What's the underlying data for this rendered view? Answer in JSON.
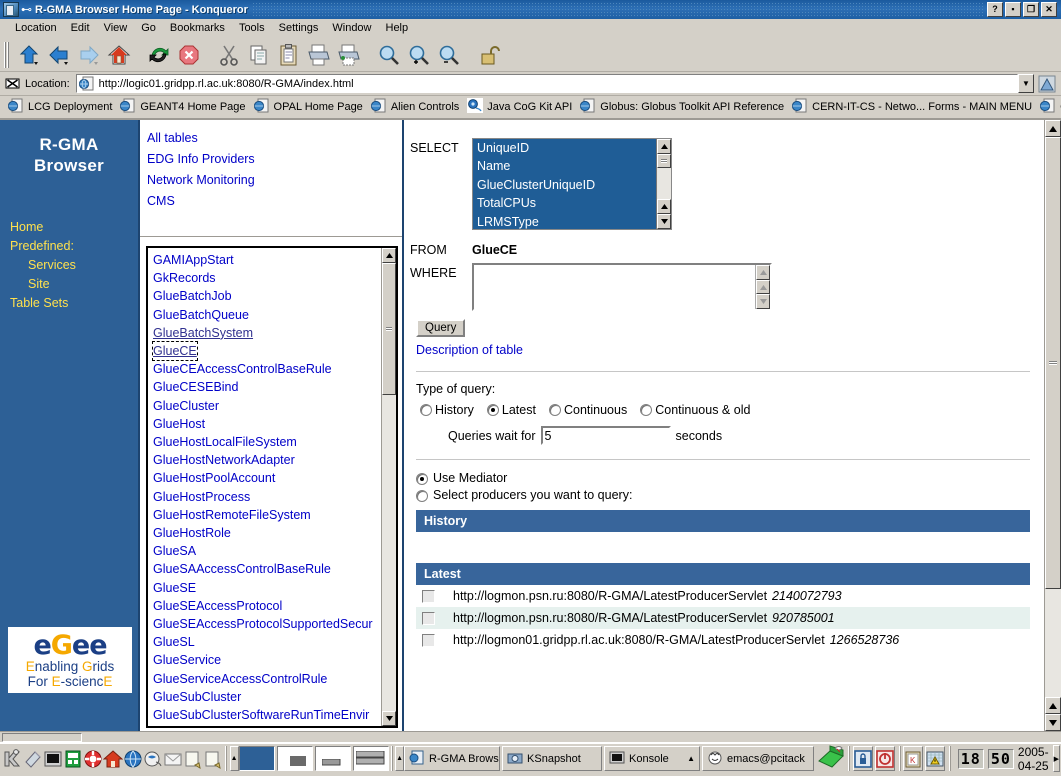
{
  "window": {
    "title": "R-GMA Browser Home Page - Konqueror",
    "icon": "konqueror-icon",
    "pin": "pin-icon",
    "buttons": [
      {
        "name": "help-button",
        "glyph": "?"
      },
      {
        "name": "minimize-button",
        "glyph": "▪"
      },
      {
        "name": "maximize-button",
        "glyph": "❐"
      },
      {
        "name": "close-button",
        "glyph": "✕"
      }
    ]
  },
  "menubar": {
    "items": [
      {
        "label": "Location",
        "accel": "L"
      },
      {
        "label": "Edit",
        "accel": "E"
      },
      {
        "label": "View",
        "accel": "V"
      },
      {
        "label": "Go",
        "accel": "G"
      },
      {
        "label": "Bookmarks",
        "accel": "B"
      },
      {
        "label": "Tools",
        "accel": "T"
      },
      {
        "label": "Settings",
        "accel": "S"
      },
      {
        "label": "Window",
        "accel": "W"
      },
      {
        "label": "Help",
        "accel": "H"
      }
    ]
  },
  "toolbar": {
    "buttons": [
      {
        "name": "up-button",
        "icon": "up-arrow-icon"
      },
      {
        "name": "back-button",
        "icon": "back-arrow-icon"
      },
      {
        "name": "forward-button",
        "icon": "forward-arrow-icon"
      },
      {
        "name": "home-button",
        "icon": "home-icon"
      },
      {
        "name": "reload-button",
        "icon": "reload-icon"
      },
      {
        "name": "stop-button",
        "icon": "stop-icon"
      },
      {
        "name": "cut-button",
        "icon": "scissors-icon"
      },
      {
        "name": "copy-button",
        "icon": "copy-icon"
      },
      {
        "name": "paste-button",
        "icon": "clipboard-paste-icon"
      },
      {
        "name": "print-button",
        "icon": "printer-icon"
      },
      {
        "name": "print-preview-button",
        "icon": "print-preview-icon"
      },
      {
        "name": "find-button",
        "icon": "magnifier-icon"
      },
      {
        "name": "zoom-in-button",
        "icon": "magnifier-plus-icon"
      },
      {
        "name": "zoom-out-button",
        "icon": "magnifier-minus-icon"
      },
      {
        "name": "security-button",
        "icon": "open-padlock-icon"
      }
    ]
  },
  "location": {
    "label": "Location:",
    "url": "http://logic01.gridpp.rl.ac.uk:8080/R-GMA/index.html",
    "clear_icon": "clear-location-icon",
    "favicon": "page-icon",
    "dropdown_glyph": "▼",
    "right_icon": "konqueror-throbber-icon"
  },
  "bookmarks": {
    "items": [
      {
        "label": "LCG Deployment",
        "icon": "bookmark-page-icon"
      },
      {
        "label": "GEANT4 Home Page",
        "icon": "bookmark-page-icon"
      },
      {
        "label": "OPAL Home Page",
        "icon": "bookmark-page-icon"
      },
      {
        "label": "Alien Controls",
        "icon": "bookmark-page-icon"
      },
      {
        "label": "Java CoG Kit API",
        "icon": "bookmark-cog-icon"
      },
      {
        "label": "Globus: Globus Toolkit API Reference",
        "icon": "bookmark-page-icon"
      },
      {
        "label": "CERN-IT-CS - Netwo... Forms - MAIN MENU",
        "icon": "bookmark-page-icon"
      },
      {
        "label": "C",
        "icon": "bookmark-page-icon"
      }
    ],
    "more_glyph": "»"
  },
  "sidebar": {
    "brand_line1": "R-GMA",
    "brand_line2": "Browser",
    "links": [
      {
        "label": "Home",
        "indent": false
      },
      {
        "label": "Predefined:",
        "indent": false
      },
      {
        "label": "Services",
        "indent": true
      },
      {
        "label": "Site",
        "indent": true
      },
      {
        "label": "Table Sets",
        "indent": false
      }
    ],
    "logo": {
      "letters": [
        {
          "char": "e",
          "color": "blue"
        },
        {
          "char": "G",
          "color": "yellow"
        },
        {
          "char": "e",
          "color": "blue"
        },
        {
          "char": "e",
          "color": "blue"
        }
      ],
      "line2": [
        {
          "text": "E",
          "color": "yellow"
        },
        {
          "text": "nabling ",
          "color": "blue"
        },
        {
          "text": "G",
          "color": "yellow"
        },
        {
          "text": "rids",
          "color": "blue"
        }
      ],
      "line3": [
        {
          "text": "For ",
          "color": "blue"
        },
        {
          "text": "E",
          "color": "yellow"
        },
        {
          "text": "-scienc",
          "color": "blue"
        },
        {
          "text": "E",
          "color": "yellow"
        }
      ]
    }
  },
  "categories": {
    "items": [
      "All tables",
      "EDG Info Providers",
      "Network Monitoring",
      "CMS"
    ]
  },
  "table_list": {
    "items": [
      {
        "name": "GAMIAppStart",
        "state": "normal"
      },
      {
        "name": "GkRecords",
        "state": "normal"
      },
      {
        "name": "GlueBatchJob",
        "state": "normal"
      },
      {
        "name": "GlueBatchQueue",
        "state": "normal"
      },
      {
        "name": "GlueBatchSystem",
        "state": "visited"
      },
      {
        "name": "GlueCE",
        "state": "focused"
      },
      {
        "name": "GlueCEAccessControlBaseRule",
        "state": "normal"
      },
      {
        "name": "GlueCESEBind",
        "state": "normal"
      },
      {
        "name": "GlueCluster",
        "state": "normal"
      },
      {
        "name": "GlueHost",
        "state": "normal"
      },
      {
        "name": "GlueHostLocalFileSystem",
        "state": "normal"
      },
      {
        "name": "GlueHostNetworkAdapter",
        "state": "normal"
      },
      {
        "name": "GlueHostPoolAccount",
        "state": "normal"
      },
      {
        "name": "GlueHostProcess",
        "state": "normal"
      },
      {
        "name": "GlueHostRemoteFileSystem",
        "state": "normal"
      },
      {
        "name": "GlueHostRole",
        "state": "normal"
      },
      {
        "name": "GlueSA",
        "state": "normal"
      },
      {
        "name": "GlueSAAccessControlBaseRule",
        "state": "normal"
      },
      {
        "name": "GlueSE",
        "state": "normal"
      },
      {
        "name": "GlueSEAccessProtocol",
        "state": "normal"
      },
      {
        "name": "GlueSEAccessProtocolSupportedSecur",
        "state": "normal"
      },
      {
        "name": "GlueSL",
        "state": "normal"
      },
      {
        "name": "GlueService",
        "state": "normal"
      },
      {
        "name": "GlueServiceAccessControlRule",
        "state": "normal"
      },
      {
        "name": "GlueSubCluster",
        "state": "normal"
      },
      {
        "name": "GlueSubClusterSoftwareRunTimeEnvir",
        "state": "clipped"
      }
    ]
  },
  "query": {
    "select_label": "SELECT",
    "select_options": [
      "UniqueID",
      "Name",
      "GlueClusterUniqueID",
      "TotalCPUs",
      "LRMSType"
    ],
    "from_label": "FROM",
    "from_value": "GlueCE",
    "where_label": "WHERE",
    "where_value": "",
    "query_button": "Query",
    "description_link": "Description of table",
    "type_label": "Type of query:",
    "type_options": [
      {
        "label": "History",
        "selected": false
      },
      {
        "label": "Latest",
        "selected": true
      },
      {
        "label": "Continuous",
        "selected": false
      },
      {
        "label": "Continuous & old",
        "selected": false
      }
    ],
    "wait_prefix": "Queries wait for",
    "wait_value": "5",
    "wait_suffix": "seconds",
    "mediator_options": [
      {
        "label": "Use Mediator",
        "selected": true
      },
      {
        "label": "Select producers you want to query:",
        "selected": false
      }
    ],
    "sections": [
      {
        "title": "History",
        "rows": []
      },
      {
        "title": "Latest",
        "rows": [
          {
            "url": "http://logmon.psn.ru:8080/R-GMA/LatestProducerServlet",
            "id": "2140072793",
            "alt": false
          },
          {
            "url": "http://logmon.psn.ru:8080/R-GMA/LatestProducerServlet",
            "id": "920785001",
            "alt": true
          },
          {
            "url": "http://logmon01.gridpp.rl.ac.uk:8080/R-GMA/LatestProducerServlet",
            "id": "1266528736",
            "alt": false
          }
        ]
      }
    ]
  },
  "taskbar": {
    "launchers": [
      {
        "name": "k-menu-icon"
      },
      {
        "name": "show-desktop-icon"
      },
      {
        "name": "terminal-icon"
      },
      {
        "name": "kcontrol-icon"
      },
      {
        "name": "help-lifebelt-icon"
      },
      {
        "name": "home-folder-icon"
      },
      {
        "name": "konqueror-globe-icon"
      },
      {
        "name": "kate-icon"
      },
      {
        "name": "mail-icon"
      },
      {
        "name": "editor-icon"
      },
      {
        "name": "editor2-icon"
      }
    ],
    "pager": [
      {
        "name": "desktop-1",
        "active": true
      },
      {
        "name": "desktop-2",
        "active": false
      },
      {
        "name": "desktop-3",
        "active": false
      },
      {
        "name": "desktop-4",
        "active": false
      }
    ],
    "tasks": [
      {
        "label": "R-GMA Brows",
        "icon": "konqueror-icon",
        "active": true
      },
      {
        "label": "KSnapshot",
        "icon": "ksnapshot-icon",
        "active": false
      },
      {
        "label": "Konsole",
        "icon": "konsole-icon",
        "active": false
      },
      {
        "label": "emacs@pcitack",
        "icon": "emacs-gnu-icon",
        "active": false
      }
    ],
    "tray": [
      {
        "name": "lock-screen-icon"
      },
      {
        "name": "logout-icon"
      },
      {
        "name": "klipper-icon"
      },
      {
        "name": "kalarm-icon"
      }
    ],
    "clock_hours": "18",
    "clock_minutes": "50",
    "date": "2005-04-25",
    "expand_glyph": "▶"
  },
  "colors": {
    "title_blue": "#2d6fb5",
    "brand_blue": "#2d6096",
    "link_blue": "#0000c8",
    "link_yellow": "#ffe14d",
    "bar_blue": "#38659b",
    "select_blue": "#1f5d96",
    "alt_row": "#e6f1ee",
    "chrome": "#d4d0c8"
  }
}
